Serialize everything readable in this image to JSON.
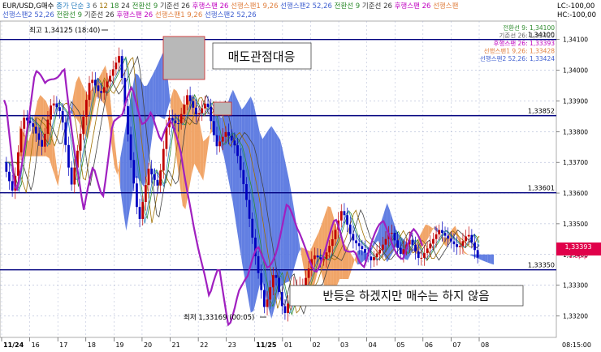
{
  "header": {
    "row1": [
      {
        "text": "EUR/USD,G매수",
        "color": "#000000"
      },
      {
        "text": "종가 단순 3",
        "color": "#2a7fbf"
      },
      {
        "text": "6",
        "color": "#555555"
      },
      {
        "text": "12",
        "color": "#a07000"
      },
      {
        "text": "18",
        "color": "#2e8b2e"
      },
      {
        "text": "24",
        "color": "#333333"
      },
      {
        "text": "전환선 9",
        "color": "#2e8b2e"
      },
      {
        "text": "기준선 26",
        "color": "#333333"
      },
      {
        "text": "후행스팬 26",
        "color": "#c000c0"
      },
      {
        "text": "선행스팬1 9,26",
        "color": "#e08040"
      },
      {
        "text": "선행스팬2 52,26",
        "color": "#4060d0"
      },
      {
        "text": "전환선 9",
        "color": "#2e8b2e"
      },
      {
        "text": "기준선 26",
        "color": "#333333"
      },
      {
        "text": "후행스팬 26",
        "color": "#c000c0"
      },
      {
        "text": "선행스팬",
        "color": "#e08040"
      }
    ],
    "row2": [
      {
        "text": "선행스팬2 52,26",
        "color": "#4060d0"
      },
      {
        "text": "전환선 9",
        "color": "#2e8b2e"
      },
      {
        "text": "기준선 26",
        "color": "#333333"
      },
      {
        "text": "후행스팬 26",
        "color": "#c000c0"
      },
      {
        "text": "선행스팬1 9,26",
        "color": "#e08040"
      },
      {
        "text": "선행스팬2 52,26",
        "color": "#4060d0"
      }
    ],
    "lc": "LC:-100,00",
    "hc": "HC:-100,00"
  },
  "legend_values": [
    {
      "text": "전환선 9: 1,34100",
      "color": "#2e8b2e"
    },
    {
      "text": "기준선 26: 1,33420",
      "color": "#666666"
    },
    {
      "text": "후행스팬 26: 1,33393",
      "color": "#c000c0"
    },
    {
      "text": "선행스팬1 9,26: 1,33428",
      "color": "#e08040"
    },
    {
      "text": "선행스팬2 52,26: 1,33424",
      "color": "#4060d0"
    }
  ],
  "annotations": {
    "high": "최고 1,34125 (18:40)",
    "low": "최저 1,33169 (00:05)",
    "sell_box": "매도관점대응",
    "rebound_box": "반등은 하겠지만 매수는 하지 않음"
  },
  "price_tag": {
    "price": "1,33393",
    "pips": "1.9pip"
  },
  "time_label": "08:15:00",
  "colors": {
    "up_candle": "#c00000",
    "down_candle": "#0000c0",
    "h_lines": "#00007f",
    "kumo_bear": "#5a78e0",
    "kumo_bull": "#f0a060",
    "lagging": "#a020c0",
    "price_tag_bg": "#e0004a",
    "grid": "#9aa5c8"
  },
  "chart_data": {
    "type": "candlestick",
    "ylim": [
      1.3313,
      1.3416
    ],
    "y_ticks": [
      "1,33200",
      "1,33300",
      "1,33400",
      "1,33500",
      "1,33600",
      "1,33700",
      "1,33800",
      "1,33900",
      "1,34000",
      "1,34100"
    ],
    "x_ticks": [
      "11/24",
      "16",
      "17",
      "18",
      "19",
      "20",
      "21",
      "22",
      "23",
      "11/25",
      "01",
      "02",
      "03",
      "04",
      "05",
      "06",
      "07",
      "08"
    ],
    "horizontal_levels": [
      {
        "value": 1.341,
        "label": "1,34100"
      },
      {
        "value": 1.33852,
        "label": "1,33852"
      },
      {
        "value": 1.33601,
        "label": "1,33601"
      },
      {
        "value": 1.3335,
        "label": "1,33350"
      }
    ],
    "last_price": 1.33393,
    "price_path": [
      [
        0,
        1.337
      ],
      [
        1,
        1.336
      ],
      [
        2,
        1.3385
      ],
      [
        3,
        1.3382
      ],
      [
        4,
        1.3375
      ],
      [
        5,
        1.339
      ],
      [
        6,
        1.3386
      ],
      [
        7,
        1.3362
      ],
      [
        8,
        1.338
      ],
      [
        9,
        1.3398
      ],
      [
        10,
        1.3392
      ],
      [
        11,
        1.3398
      ],
      [
        12,
        1.3405
      ],
      [
        13,
        1.3375
      ],
      [
        14,
        1.335
      ],
      [
        15,
        1.3368
      ],
      [
        16,
        1.3362
      ],
      [
        17,
        1.3385
      ],
      [
        18,
        1.3382
      ],
      [
        19,
        1.3392
      ],
      [
        20,
        1.3385
      ],
      [
        21,
        1.339
      ],
      [
        22,
        1.3375
      ],
      [
        23,
        1.338
      ],
      [
        24,
        1.3375
      ],
      [
        25,
        1.336
      ],
      [
        26,
        1.334
      ],
      [
        27,
        1.3322
      ],
      [
        28,
        1.3335
      ],
      [
        29,
        1.332
      ],
      [
        30,
        1.333
      ],
      [
        31,
        1.333
      ],
      [
        32,
        1.334
      ],
      [
        33,
        1.3338
      ],
      [
        34,
        1.3345
      ],
      [
        35,
        1.3355
      ],
      [
        36,
        1.3345
      ],
      [
        37,
        1.3342
      ],
      [
        38,
        1.3338
      ],
      [
        39,
        1.3342
      ],
      [
        40,
        1.3348
      ],
      [
        41,
        1.334
      ],
      [
        42,
        1.3345
      ],
      [
        43,
        1.3338
      ],
      [
        44,
        1.3343
      ],
      [
        45,
        1.3348
      ],
      [
        46,
        1.3345
      ],
      [
        47,
        1.3342
      ],
      [
        48,
        1.3347
      ],
      [
        49,
        1.3339
      ]
    ]
  }
}
